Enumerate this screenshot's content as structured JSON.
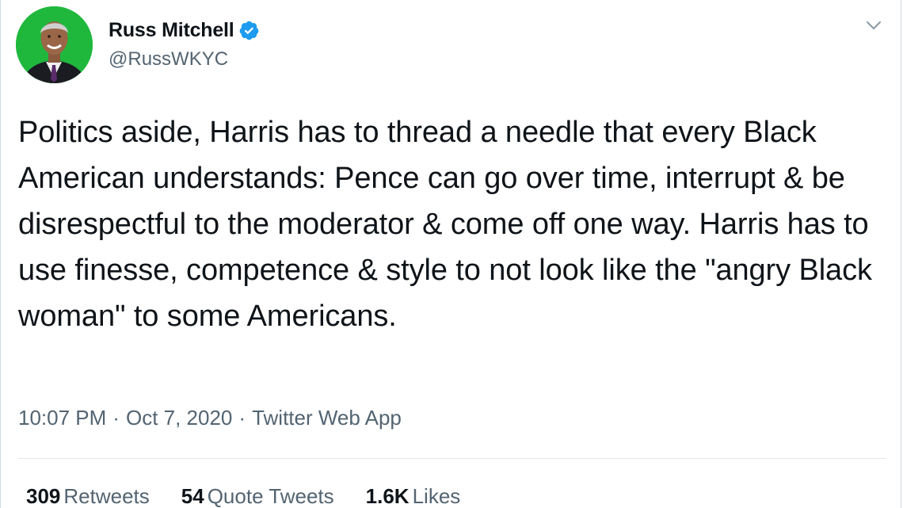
{
  "author": {
    "display_name": "Russ Mitchell",
    "handle": "@RussWKYC",
    "verified": true,
    "avatar_bg": "#1fb83d"
  },
  "icons": {
    "verified": "verified-badge-icon",
    "menu": "chevron-down-icon"
  },
  "tweet": {
    "text": "Politics aside, Harris has to thread a needle that every Black American understands: Pence can go over time, interrupt & be disrespectful to the moderator & come off one way. Harris has to use finesse, competence & style to not look like the \"angry Black woman\" to some Americans.",
    "time": "10:07 PM",
    "separator": "·",
    "date": "Oct 7, 2020",
    "source": "Twitter Web App"
  },
  "stats": {
    "retweets_count": "309",
    "retweets_label": "Retweets",
    "quote_count": "54",
    "quote_label": "Quote Tweets",
    "likes_count": "1.6K",
    "likes_label": "Likes"
  },
  "colors": {
    "text_primary": "#0f1419",
    "text_secondary": "#536471",
    "verified_blue": "#1d9bf0"
  }
}
